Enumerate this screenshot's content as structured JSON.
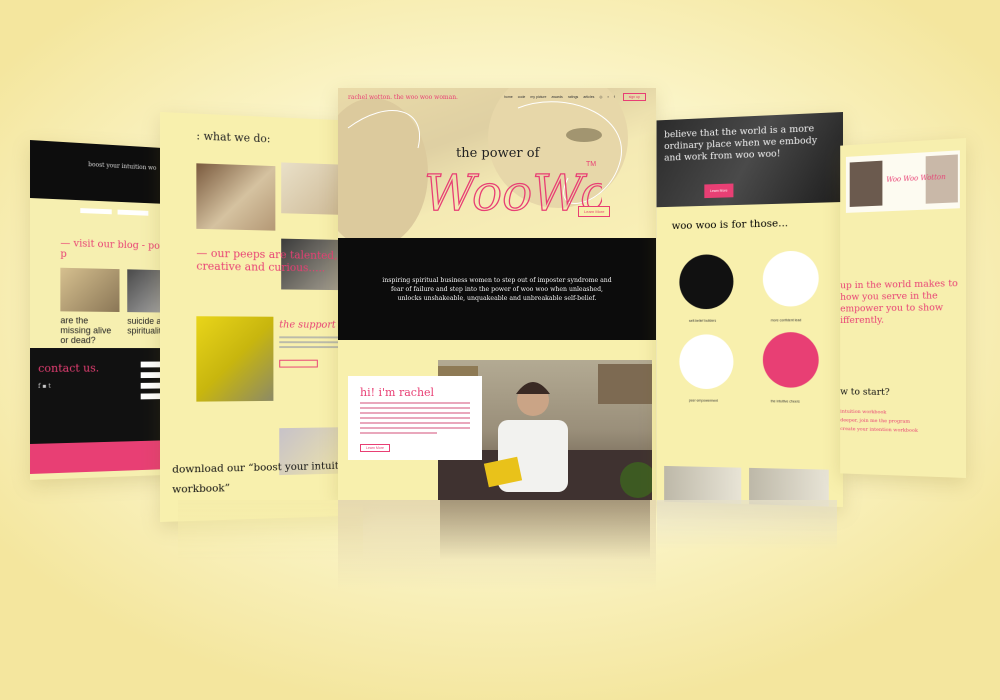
{
  "colors": {
    "accent": "#e83f74",
    "cream": "#f8f0ad",
    "black": "#0c0c0c"
  },
  "page1": {
    "hero_title": "boost your intuition wo",
    "blog_heading": "— visit our blog - popular p",
    "posts": [
      {
        "title": "are the missing alive or dead?"
      },
      {
        "title": "suicide and spirituality"
      }
    ],
    "contact_heading": "contact us.",
    "social": "f ▪ t"
  },
  "page2": {
    "section_title": ": what we do:",
    "peeps_text": "— our peeps are talented, creative and curious.....",
    "support_heading": "the support you",
    "download_text": "download our “boost your intuition workbook”"
  },
  "center": {
    "brand": "rachel wotton. the woo woo woman.",
    "nav_links": [
      "home",
      "code",
      "my picture",
      "awards",
      "ratings",
      "articles"
    ],
    "nav_icons": [
      "instagram-icon",
      "linkedin-icon",
      "facebook-icon"
    ],
    "signup_label": "sign up",
    "hero_prefix": "the power of",
    "hero_script": "WooWoo",
    "hero_tm": "TM",
    "hero_button": "Learn More",
    "tagline": "inspiring spiritual business women to step out of imposter syndrome and fear of failure and step into the power of woo woo when unleashed, unlocks unshakeable, unquakeable and unbreakable self-belief.",
    "intro_title": "hi! i'm rachel",
    "intro_button": "Learn More"
  },
  "page4": {
    "banner": "believe that the world is a more ordinary place when we embody and work from woo woo!",
    "banner_button": "Learn More",
    "for_heading": "woo woo is for those...",
    "circles": [
      {
        "caption": "self-belief builders"
      },
      {
        "caption": "more confident lead"
      },
      {
        "caption": "peer empowerment"
      },
      {
        "caption": "the intuitive cheers"
      }
    ]
  },
  "page5": {
    "script_title": "Woo Woo Wotton",
    "body": "up in the world makes to how you serve in the empower you to show ifferently.",
    "how_heading": "w to start?",
    "list": [
      "intuition workbook",
      "deeper, join me the program",
      "create your intention workbook"
    ]
  }
}
